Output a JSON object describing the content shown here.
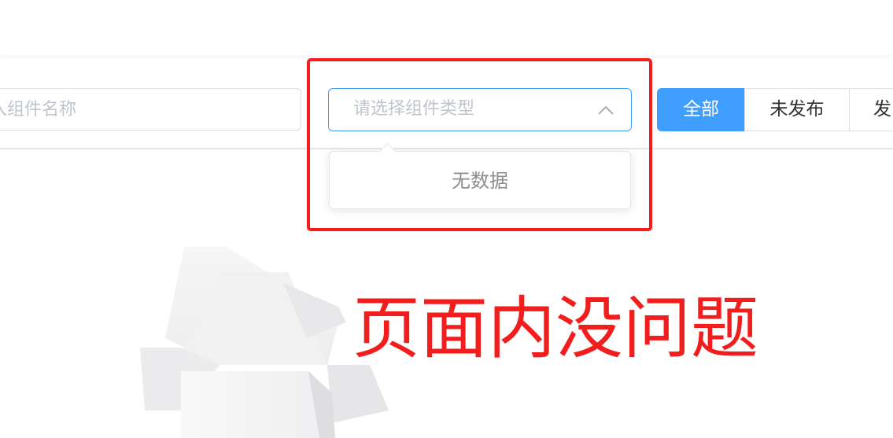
{
  "search": {
    "name_placeholder": "入组件名称",
    "type_placeholder": "请选择组件类型"
  },
  "dropdown": {
    "empty_text": "无数据"
  },
  "status_filter": {
    "items": [
      {
        "label": "全部",
        "active": true
      },
      {
        "label": "未发布",
        "active": false
      },
      {
        "label": "发",
        "active": false
      }
    ]
  },
  "annotation": {
    "text": "页面内没问题"
  },
  "colors": {
    "primary": "#409eff",
    "annotation_red": "#f21d1d",
    "border": "#dcdfe6",
    "placeholder": "#c0c4cc"
  },
  "icons": {
    "select_arrow": "chevron-up-icon",
    "empty_state": "empty-box-icon"
  }
}
